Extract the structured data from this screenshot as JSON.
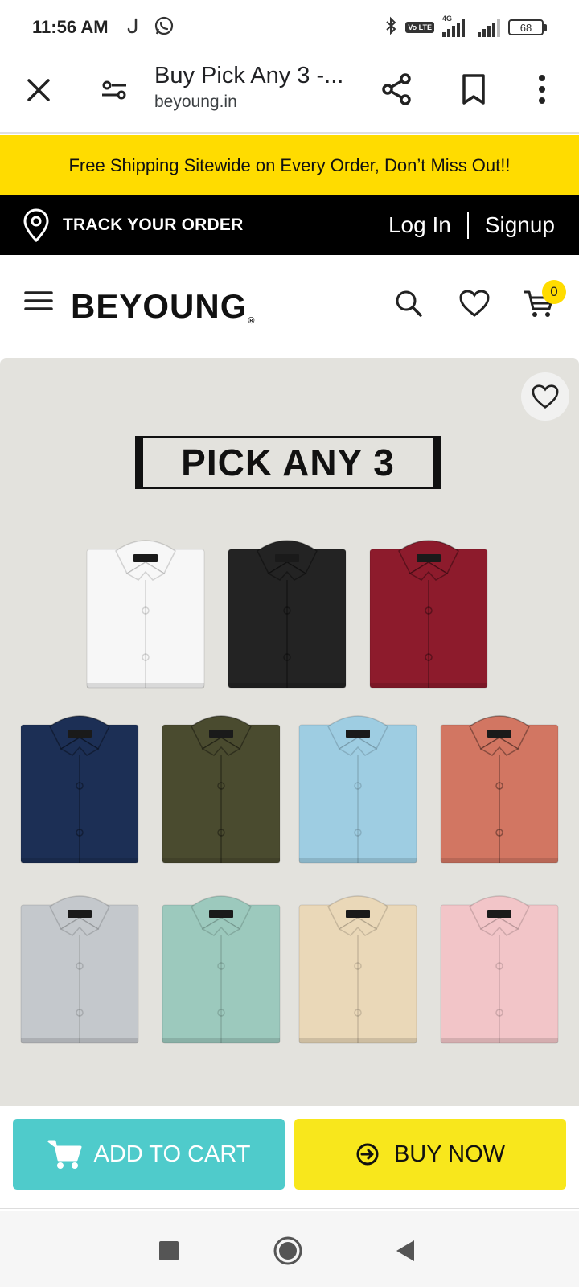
{
  "status_bar": {
    "time": "11:56 AM",
    "network": "4G",
    "volte": "Vo LTE",
    "battery": "68"
  },
  "browser": {
    "page_title": "Buy Pick Any 3 -...",
    "domain": "beyoung.in"
  },
  "promo": {
    "text": "Free Shipping Sitewide on Every Order, Don’t Miss Out!!"
  },
  "top_bar": {
    "track_label": "TRACK YOUR ORDER",
    "login_label": "Log In",
    "signup_label": "Signup"
  },
  "header": {
    "logo": "BEYOUNG",
    "logo_mark": "®",
    "cart_count": "0"
  },
  "product": {
    "banner_text": "PICK ANY 3",
    "shirt_colors": [
      "#f7f7f7",
      "#232323",
      "#8d1b2c",
      "#1c2f55",
      "#4a4b2f",
      "#9ecde2",
      "#d27662",
      "#c4c8cc",
      "#9cc9bd",
      "#ead8b8",
      "#f2c5c8"
    ]
  },
  "actions": {
    "add_to_cart": "ADD TO CART",
    "buy_now": "BUY NOW"
  },
  "colors": {
    "promo_yellow": "#ffdc00",
    "cart_teal": "#4fcbcb",
    "buy_yellow": "#f8e71c"
  }
}
